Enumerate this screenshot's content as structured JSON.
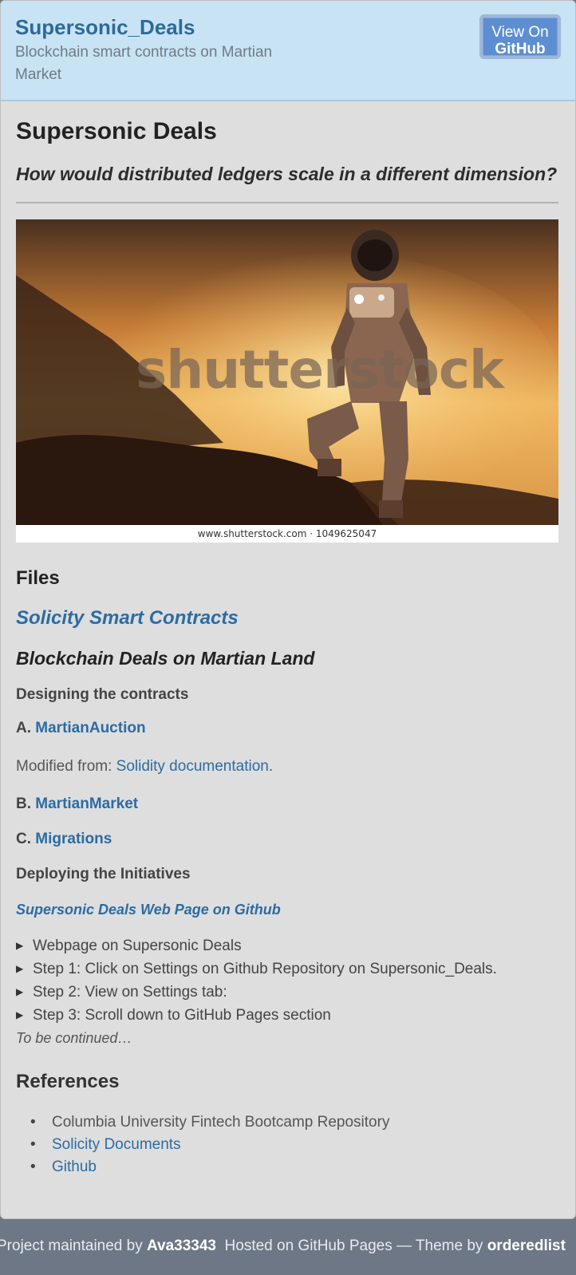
{
  "header": {
    "site_title": "Supersonic_Deals",
    "tagline": "Blockchain smart contracts on Martian Market",
    "github_button": {
      "line1": "View On",
      "line2": "GitHub"
    }
  },
  "main": {
    "title": "Supersonic Deals",
    "question": "How would distributed ledgers scale in a different dimension?",
    "hero": {
      "watermark": "shutterstock",
      "caption": "www.shutterstock.com · 1049625047"
    },
    "files_heading": "Files",
    "solicity_link": "Solicity Smart Contracts",
    "deals_heading": "Blockchain Deals on Martian Land",
    "designing_heading": "Designing the contracts",
    "contracts": [
      {
        "prefix": "A.",
        "label": "MartianAuction"
      },
      {
        "prefix": "B.",
        "label": "MartianMarket"
      },
      {
        "prefix": "C.",
        "label": "Migrations"
      }
    ],
    "modified": {
      "prefix": "Modified from: ",
      "link": "Solidity documentation",
      "suffix": "."
    },
    "deploying_heading": "Deploying the Initiatives",
    "web_page_link": "Supersonic Deals Web Page on Github",
    "steps": [
      "Webpage on Supersonic Deals",
      "Step 1: Click on Settings on Github Repository on Supersonic_Deals.",
      "Step 2: View on Settings tab:",
      "Step 3: Scroll down to GitHub Pages section"
    ],
    "continued": "To be continued…",
    "references_heading": "References",
    "references": [
      {
        "label": "Columbia University Fintech Bootcamp Repository",
        "link": false
      },
      {
        "label": "Solicity Documents",
        "link": true
      },
      {
        "label": "Github",
        "link": true
      }
    ]
  },
  "footer": {
    "maintained_prefix": "Project maintained by ",
    "maintainer": "Ava33343",
    "hosted": " Hosted on GitHub Pages — Theme by ",
    "theme_author": "orderedlist"
  },
  "colors": {
    "header_bg": "#c8e3f4",
    "link": "#2b6ca3",
    "page_bg": "#6d7785",
    "card_bg": "#dedede"
  }
}
